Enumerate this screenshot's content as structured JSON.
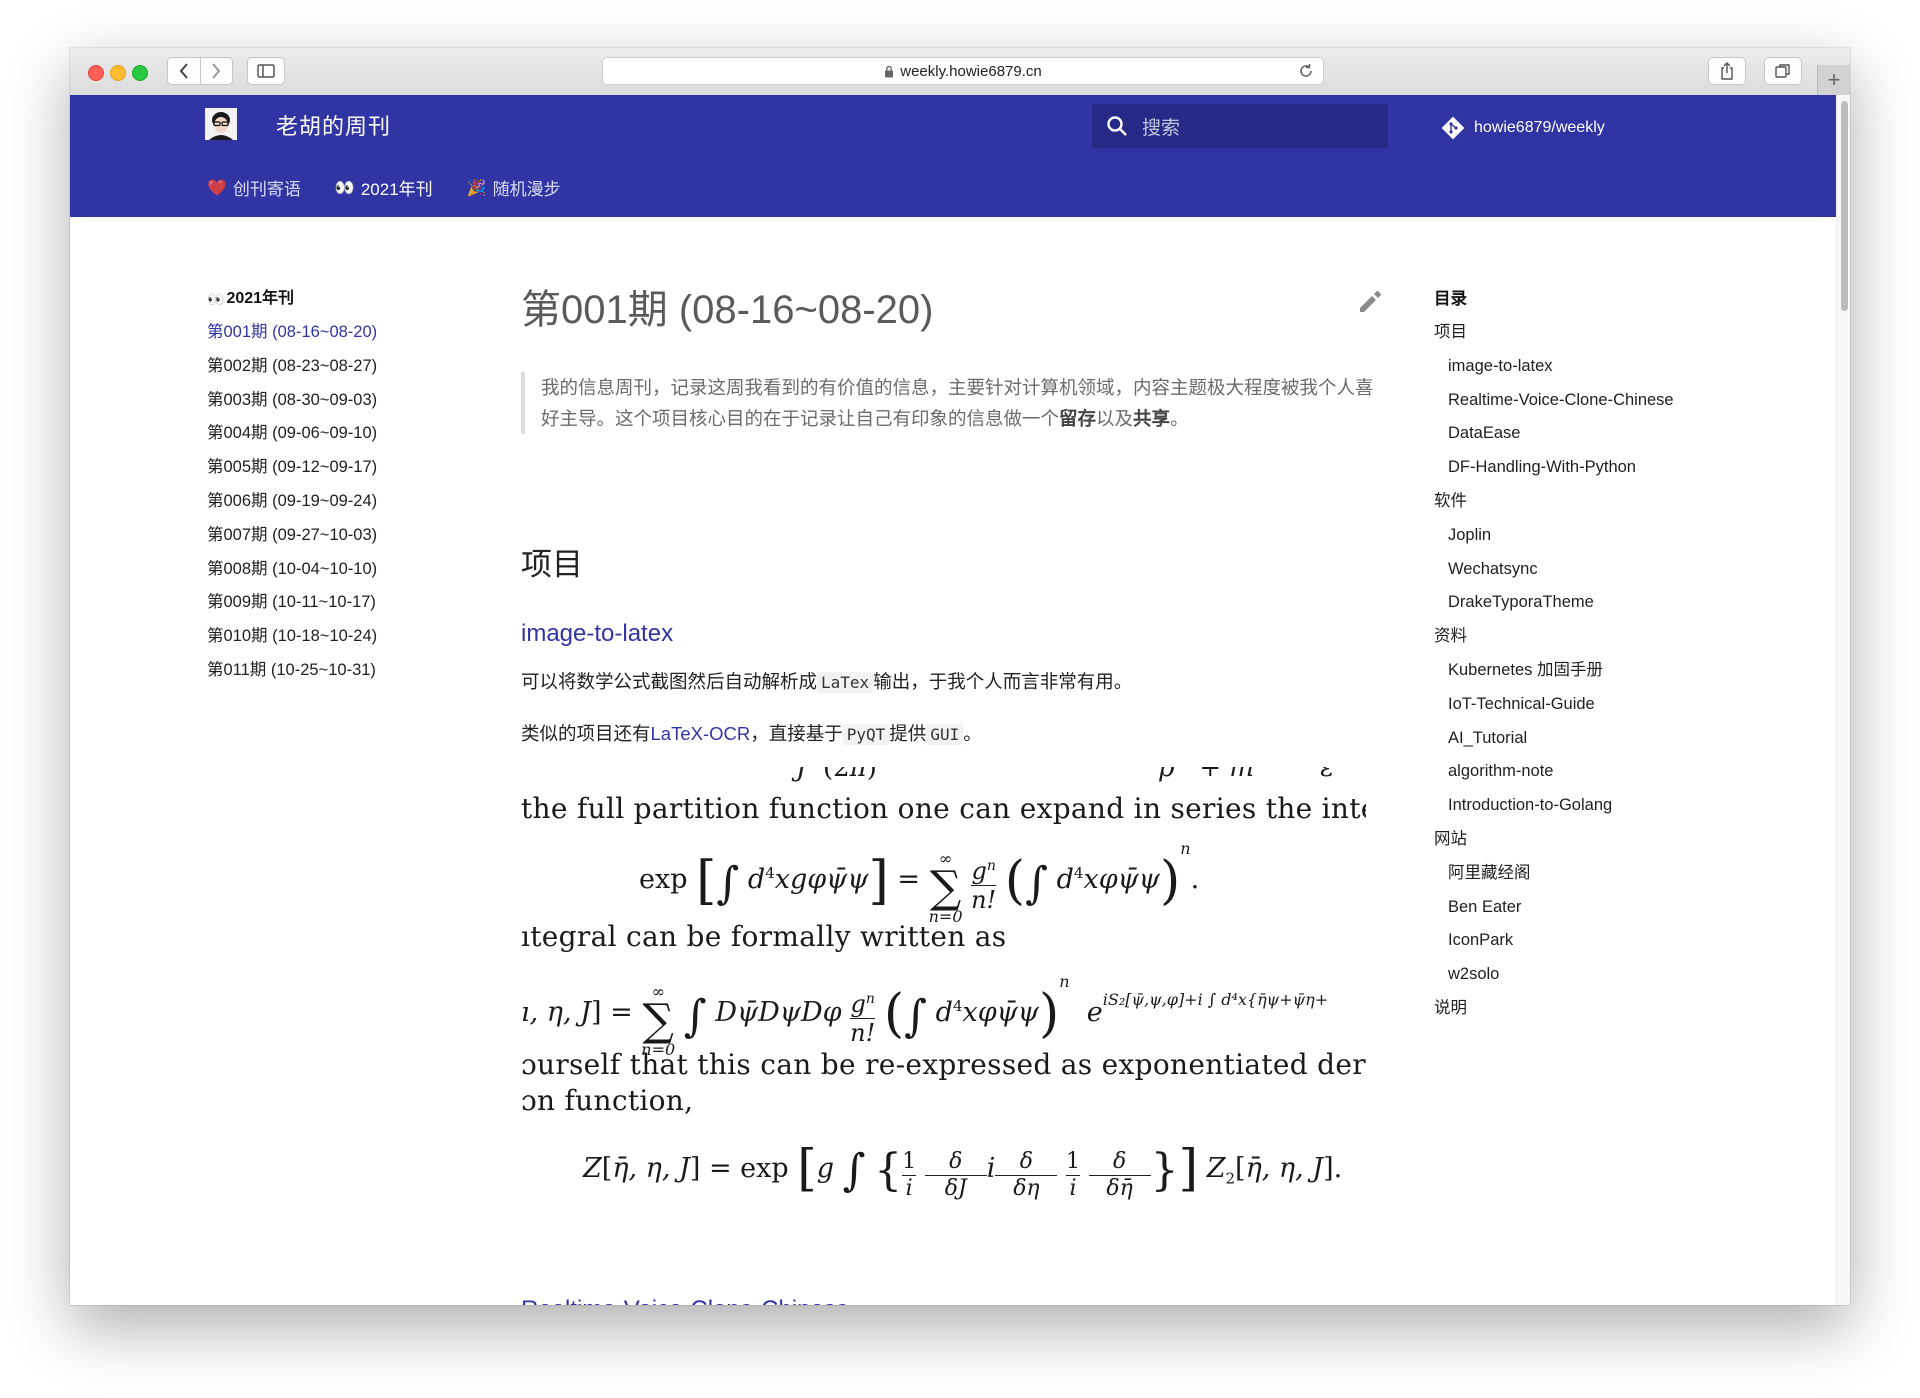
{
  "browser": {
    "url": "weekly.howie6879.cn"
  },
  "header": {
    "site_title": "老胡的周刊",
    "search_placeholder": "搜索",
    "repo": "howie6879/weekly",
    "tabs": [
      {
        "icon": "❤️",
        "label": "创刊寄语"
      },
      {
        "icon": "👀",
        "label": "2021年刊"
      },
      {
        "icon": "🎉",
        "label": "随机漫步"
      }
    ]
  },
  "left_nav": {
    "title_icon": "👀",
    "title": "2021年刊",
    "issues": [
      "第001期 (08-16~08-20)",
      "第002期 (08-23~08-27)",
      "第003期 (08-30~09-03)",
      "第004期 (09-06~09-10)",
      "第005期 (09-12~09-17)",
      "第006期 (09-19~09-24)",
      "第007期 (09-27~10-03)",
      "第008期 (10-04~10-10)",
      "第009期 (10-11~10-17)",
      "第010期 (10-18~10-24)",
      "第011期 (10-25~10-31)"
    ],
    "active_index": 0
  },
  "article": {
    "title": "第001期 (08-16~08-20)",
    "quote_before": "我的信息周刊，记录这周我看到的有价值的信息，主要针对计算机领域，内容主题极大程度被我个人喜好主导。这个项目核心目的在于记录让自己有印象的信息做一个",
    "quote_bold_1": "留存",
    "quote_mid": "以及",
    "quote_bold_2": "共享",
    "quote_end": "。",
    "section_heading": "项目",
    "project_1": {
      "title": "image-to-latex",
      "desc_before": "可以将数学公式截图然后自动解析成",
      "desc_code": "LaTex",
      "desc_after": "输出，于我个人而言非常有用。",
      "similar_before": "类似的项目还有",
      "similar_link": "LaTeX-OCR",
      "similar_mid": "，直接基于",
      "similar_code_1": "PyQT",
      "similar_mid2": "提供",
      "similar_code_2": "GUI",
      "similar_end": "。"
    },
    "demo_image": {
      "line_1": "the full partition function one can expand in series the interaction",
      "line_2": "ıtegral can be formally written as",
      "line_3": "ɔurself that this can be re-expressed as exponentiated derivatives a",
      "line_4": "ɔn function,"
    },
    "project_2_title": "Realtime-Voice-Clone-Chinese"
  },
  "toc": {
    "title": "目录",
    "sections": [
      {
        "label": "项目",
        "items": [
          "image-to-latex",
          "Realtime-Voice-Clone-Chinese",
          "DataEase",
          "DF-Handling-With-Python"
        ]
      },
      {
        "label": "软件",
        "items": [
          "Joplin",
          "Wechatsync",
          "DrakeTyporaTheme"
        ]
      },
      {
        "label": "资料",
        "items": [
          "Kubernetes 加固手册",
          "IoT-Technical-Guide",
          "AI_Tutorial",
          "algorithm-note",
          "Introduction-to-Golang"
        ]
      },
      {
        "label": "网站",
        "items": [
          "阿里藏经阁",
          "Ben Eater",
          "IconPark",
          "w2solo"
        ]
      },
      {
        "label": "说明",
        "items": []
      }
    ]
  },
  "colors": {
    "primary": "#3135a4",
    "primary_dark": "#262a86",
    "link": "#3135a4"
  }
}
